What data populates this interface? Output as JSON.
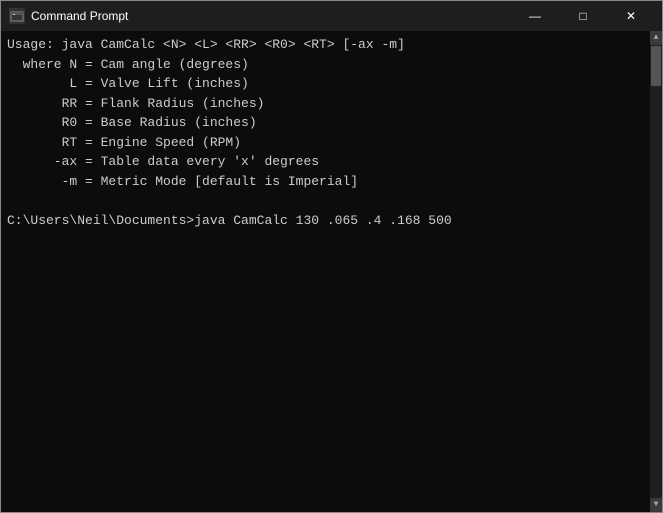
{
  "window": {
    "title": "Command Prompt",
    "icon_label": "C:"
  },
  "title_controls": {
    "minimize": "—",
    "maximize": "□",
    "close": "✕"
  },
  "console": {
    "lines": [
      "Usage: java CamCalc <N> <L> <RR> <R0> <RT> [-ax -m]",
      "  where N = Cam angle (degrees)",
      "        L = Valve Lift (inches)",
      "       RR = Flank Radius (inches)",
      "       R0 = Base Radius (inches)",
      "       RT = Engine Speed (RPM)",
      "      -ax = Table data every 'x' degrees",
      "       -m = Metric Mode [default is Imperial]",
      "",
      "C:\\Users\\Neil\\Documents>java CamCalc 130 .065 .4 .168 500"
    ]
  }
}
